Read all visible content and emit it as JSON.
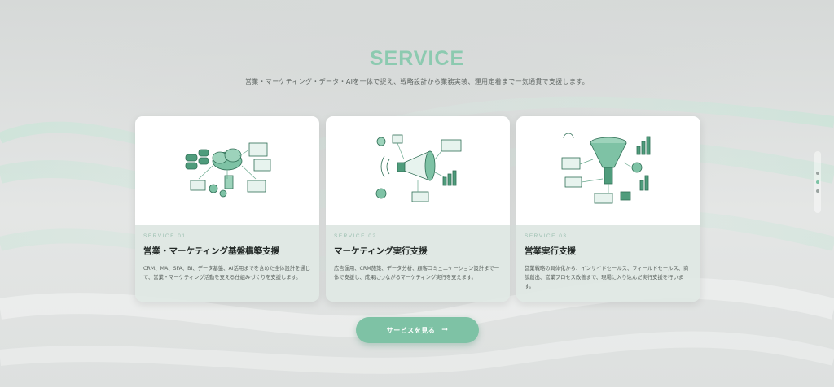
{
  "section": {
    "title": "SERVICE",
    "subtitle": "営業・マーケティング・データ・AIを一体で捉え、戦略設計から業務実装、運用定着まで一気通貫で支援します。"
  },
  "cards": [
    {
      "label": "SERVICE 01",
      "title": "営業・マーケティング基盤構築支援",
      "description": "CRM、MA、SFA、BI、データ基盤、AI活用までを含めた全体設計を通じて、営業・マーケティング活動を支える仕組みづくりを支援します。",
      "icon": "cloud-data-infrastructure-icon"
    },
    {
      "label": "SERVICE 02",
      "title": "マーケティング実行支援",
      "description": "広告運用、CRM施策、データ分析、顧客コミュニケーション設計まで一体で支援し、成果につながるマーケティング実行を支えます。",
      "icon": "megaphone-marketing-icon"
    },
    {
      "label": "SERVICE 03",
      "title": "営業実行支援",
      "description": "営業戦略の具体化から、インサイドセールス、フィールドセールス、商談創出、営業プロセス改善まで、現場に入り込んだ実行支援を行います。",
      "icon": "sales-funnel-icon"
    }
  ],
  "cta": {
    "label": "サービスを見る",
    "arrow": "→"
  },
  "colors": {
    "accent": "#7ec2a5",
    "heading": "#8ccab0",
    "illustration": "#4f9c7c"
  }
}
